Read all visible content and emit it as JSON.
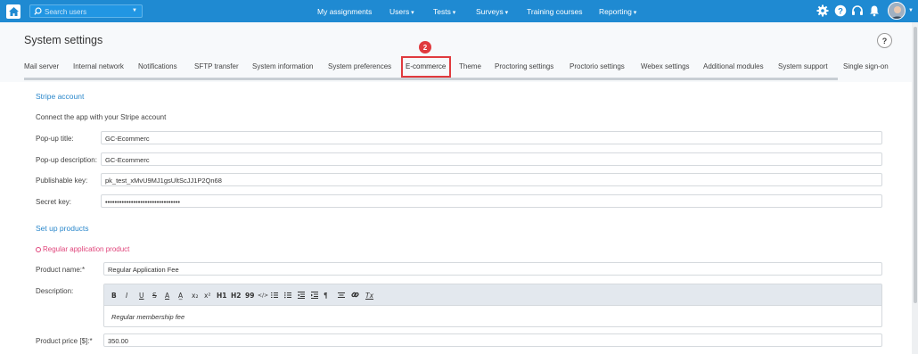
{
  "topbar": {
    "search_placeholder": "Search users",
    "nav": [
      {
        "label": "My assignments",
        "dropdown": false
      },
      {
        "label": "Users",
        "dropdown": true
      },
      {
        "label": "Tests",
        "dropdown": true
      },
      {
        "label": "Surveys",
        "dropdown": true
      },
      {
        "label": "Training courses",
        "dropdown": false
      },
      {
        "label": "Reporting",
        "dropdown": true
      }
    ],
    "icons": [
      "gear-icon",
      "help-icon",
      "headset-icon",
      "bell-icon"
    ],
    "colors": {
      "bar": "#1f8ad2"
    }
  },
  "header": {
    "title": "System settings",
    "help_label": "?",
    "step_badge": "2",
    "tabs": [
      "Mail server",
      "Internal network",
      "Notifications",
      "SFTP transfer",
      "System information",
      "System preferences",
      "E-commerce",
      "Theme",
      "Proctoring settings",
      "Proctorio settings",
      "Webex settings",
      "Additional modules",
      "System support",
      "Single sign-on"
    ],
    "active_tab": "E-commerce"
  },
  "stripe": {
    "section_title": "Stripe account",
    "intro": "Connect the app with your Stripe account",
    "popup_title_label": "Pop-up title:",
    "popup_title_value": "GC-Ecommerc",
    "popup_description_label": "Pop-up description:",
    "popup_description_value": "GC-Ecommerc",
    "publishable_key_label": "Publishable key:",
    "publishable_key_value": "pk_test_xMvU9MJ1gsUltScJJ1P2Qn68",
    "secret_key_label": "Secret key:",
    "secret_key_value": "••••••••••••••••••••••••••••••••"
  },
  "products": {
    "section_title": "Set up products",
    "product_type": "Regular application product",
    "product_name_label": "Product name:*",
    "product_name_value": "Regular Application Fee",
    "description_label": "Description:",
    "description_value": "Regular membership fee",
    "price_label": "Product price [$]:*",
    "price_value": "350.00",
    "toolbar": [
      "B",
      "I",
      "U",
      "S",
      "A",
      "A̲",
      "x₂",
      "x²",
      "H1",
      "H2",
      "99",
      "</>",
      "ol",
      "ul",
      "outdent",
      "indent",
      "¶",
      "align",
      "link",
      "Tx"
    ]
  },
  "colors": {
    "accent": "#2a87cb",
    "highlight": "#e03a3e",
    "product_label": "#e0457b"
  }
}
